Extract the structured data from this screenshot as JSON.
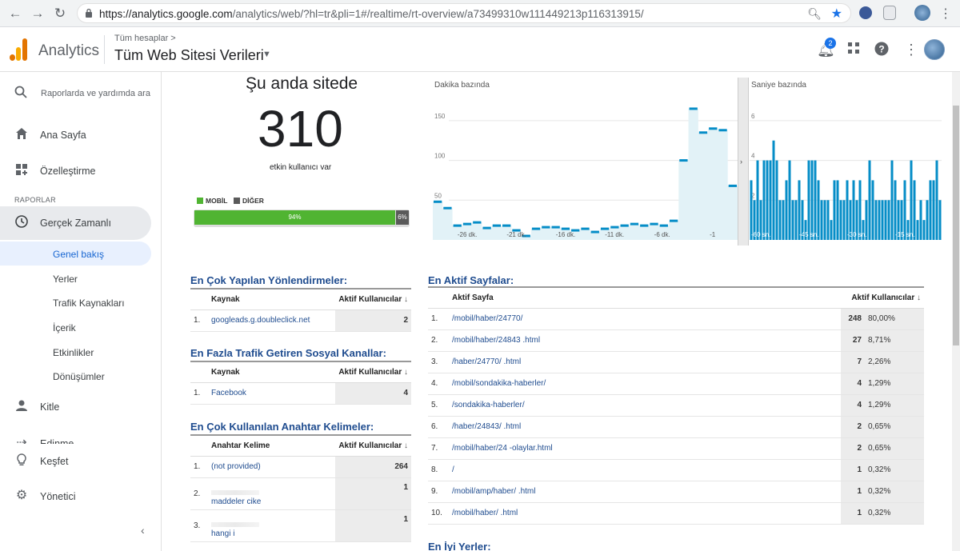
{
  "browser": {
    "url_host": "https://analytics.google.com",
    "url_path": "/analytics/web/?hl=tr&pli=1#/realtime/rt-overview/a73499310w111449213p116313915/"
  },
  "header": {
    "app_name": "Analytics",
    "crumb": "Tüm hesaplar >",
    "property": "Tüm Web Sitesi Verileri",
    "notification_count": "2"
  },
  "sidebar": {
    "search_placeholder": "Raporlarda ve yardımda ara",
    "home": "Ana Sayfa",
    "customize": "Özelleştirme",
    "section": "RAPORLAR",
    "realtime": "Gerçek Zamanlı",
    "sub": [
      "Genel bakış",
      "Yerler",
      "Trafik Kaynakları",
      "İçerik",
      "Etkinlikler",
      "Dönüşümler"
    ],
    "audience": "Kitle",
    "acquisition": "Edinme",
    "discover": "Keşfet",
    "admin": "Yönetici"
  },
  "overview": {
    "title": "Şu anda sitede",
    "active_users": "310",
    "subtitle": "etkin kullanıcı var",
    "legend_mobile": "MOBİL",
    "legend_other": "DİĞER",
    "mobile_pct": "94%",
    "other_pct": "6%",
    "mobile_fraction": 0.94
  },
  "colors": {
    "mobile": "#50b432",
    "other": "#5a5a5a",
    "bar": "#058dc7",
    "link": "#1f4c8f"
  },
  "chart_data": [
    {
      "type": "area",
      "title": "Dakika bazında",
      "ylim": [
        0,
        175
      ],
      "y_ticks": [
        50,
        100,
        150
      ],
      "x_labels": [
        "-26 dk.",
        "-21 dk.",
        "-16 dk.",
        "-11 dk.",
        "-6 dk.",
        "-1"
      ],
      "values": [
        48,
        40,
        18,
        20,
        22,
        15,
        18,
        18,
        12,
        5,
        14,
        16,
        16,
        14,
        12,
        14,
        10,
        14,
        16,
        18,
        20,
        18,
        20,
        18,
        24,
        100,
        165,
        135,
        140,
        138,
        68
      ]
    },
    {
      "type": "bar",
      "title": "Saniye bazında",
      "ylim": [
        0,
        7
      ],
      "y_ticks": [
        2,
        4,
        6
      ],
      "x_labels": [
        "-60 sn.",
        "-45 sn.",
        "-30 sn.",
        "-15 sn."
      ],
      "values": [
        3,
        2,
        4,
        2,
        4,
        4,
        4,
        5,
        4,
        2,
        2,
        3,
        4,
        2,
        2,
        3,
        2,
        1,
        4,
        4,
        4,
        3,
        2,
        2,
        2,
        1,
        3,
        3,
        2,
        2,
        3,
        2,
        3,
        2,
        3,
        1,
        2,
        4,
        3,
        2,
        2,
        2,
        2,
        2,
        4,
        3,
        2,
        2,
        3,
        1,
        4,
        3,
        1,
        2,
        1,
        2,
        3,
        3,
        4,
        2
      ]
    }
  ],
  "referrals": {
    "title": "En Çok Yapılan Yönlendirmeler:",
    "col1": "Kaynak",
    "col2": "Aktif Kullanıcılar",
    "rows": [
      {
        "idx": "1.",
        "name": "googleads.g.doubleclick.net",
        "value": "2"
      }
    ]
  },
  "social": {
    "title": "En Fazla Trafik Getiren Sosyal Kanallar:",
    "col1": "Kaynak",
    "col2": "Aktif Kullanıcılar",
    "rows": [
      {
        "idx": "1.",
        "name": "Facebook",
        "value": "4"
      }
    ]
  },
  "keywords": {
    "title": "En Çok Kullanılan Anahtar Kelimeler:",
    "col1": "Anahtar Kelime",
    "col2": "Aktif Kullanıcılar",
    "rows": [
      {
        "idx": "1.",
        "name": "(not provided)",
        "value": "264"
      },
      {
        "idx": "2.",
        "name": "maddeler cike",
        "value": "1"
      },
      {
        "idx": "3.",
        "name": "hangi i",
        "value": "1"
      }
    ]
  },
  "pages": {
    "title": "En Aktif Sayfalar:",
    "col1": "Aktif Sayfa",
    "col2": "Aktif Kullanıcılar",
    "rows": [
      {
        "idx": "1.",
        "name": "/mobil/haber/24770/",
        "value": "248",
        "pct": "80,00%"
      },
      {
        "idx": "2.",
        "name": "/mobil/haber/24843 .html",
        "value": "27",
        "pct": "8,71%"
      },
      {
        "idx": "3.",
        "name": "/haber/24770/ .html",
        "value": "7",
        "pct": "2,26%"
      },
      {
        "idx": "4.",
        "name": "/mobil/sondakika-haberler/",
        "value": "4",
        "pct": "1,29%"
      },
      {
        "idx": "5.",
        "name": "/sondakika-haberler/",
        "value": "4",
        "pct": "1,29%"
      },
      {
        "idx": "6.",
        "name": "/haber/24843/ .html",
        "value": "2",
        "pct": "0,65%"
      },
      {
        "idx": "7.",
        "name": "/mobil/haber/24 -olaylar.html",
        "value": "2",
        "pct": "0,65%"
      },
      {
        "idx": "8.",
        "name": "/",
        "value": "1",
        "pct": "0,32%"
      },
      {
        "idx": "9.",
        "name": "/mobil/amp/haber/ .html",
        "value": "1",
        "pct": "0,32%"
      },
      {
        "idx": "10.",
        "name": "/mobil/haber/ .html",
        "value": "1",
        "pct": "0,32%"
      }
    ]
  },
  "locations": {
    "title": "En İyi Yerler:"
  }
}
